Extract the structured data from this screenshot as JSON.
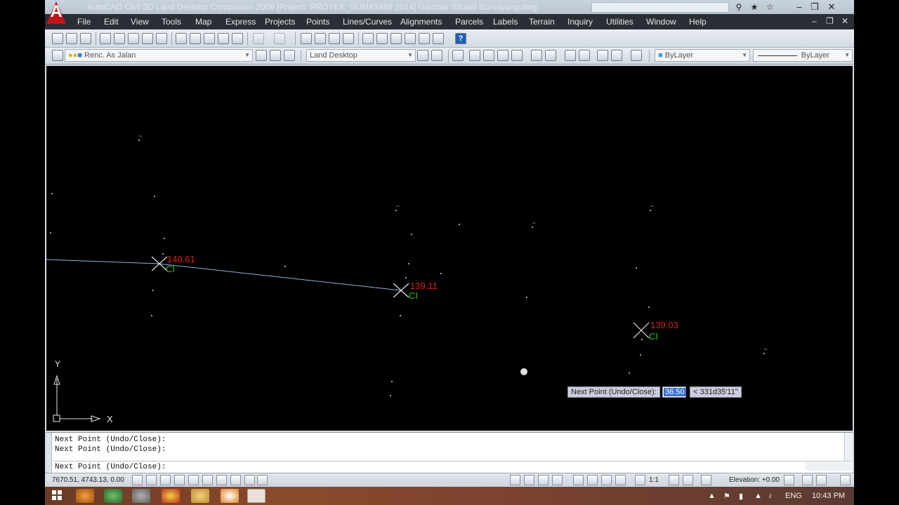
{
  "title_bar": {
    "app_icon": "autocad-logo-icon",
    "title": "AutoCAD Civil 3D Land Desktop Companion 2009 [Project: PROYEK_SUMAYANI 2014] Gambar Situasi Borsayang.dwg"
  },
  "menu": {
    "items": [
      "File",
      "Edit",
      "View",
      "Tools",
      "Map",
      "Express",
      "Projects",
      "Points",
      "Lines/Curves",
      "Alignments",
      "Parcels",
      "Labels",
      "Terrain",
      "Inquiry",
      "Utilities",
      "Window",
      "Help"
    ]
  },
  "toolbar": {
    "layer_combo": "Renc. As Jalan",
    "workspace_combo": "Land Desktop",
    "color_combo": "ByLayer",
    "linetype_combo": "ByLayer"
  },
  "canvas": {
    "stations": [
      {
        "label": "140.61",
        "code": "CI"
      },
      {
        "label": "139.11",
        "code": "CI"
      },
      {
        "label": "139.03",
        "code": "CI"
      }
    ],
    "ucs_x": "X",
    "ucs_y": "Y"
  },
  "dynamic_input": {
    "prompt": "Next Point (Undo/Close):",
    "distance": "36.50",
    "angle": "< 331d35'11\""
  },
  "command_line": {
    "history": [
      "Next Point (Undo/Close):",
      "Next Point (Undo/Close):"
    ],
    "current": "Next Point (Undo/Close):"
  },
  "status_bar": {
    "coordinates": "7670.51, 4743.13, 0.00",
    "scale": "1:1",
    "elevation": "Elevation: +0.00"
  },
  "taskbar": {
    "language": "ENG",
    "time": "10:43 PM"
  },
  "colors": {
    "canvas_bg": "#000000",
    "polyline": "#8fb3d8",
    "station_label": "#e02020",
    "code_label": "#30c030"
  }
}
